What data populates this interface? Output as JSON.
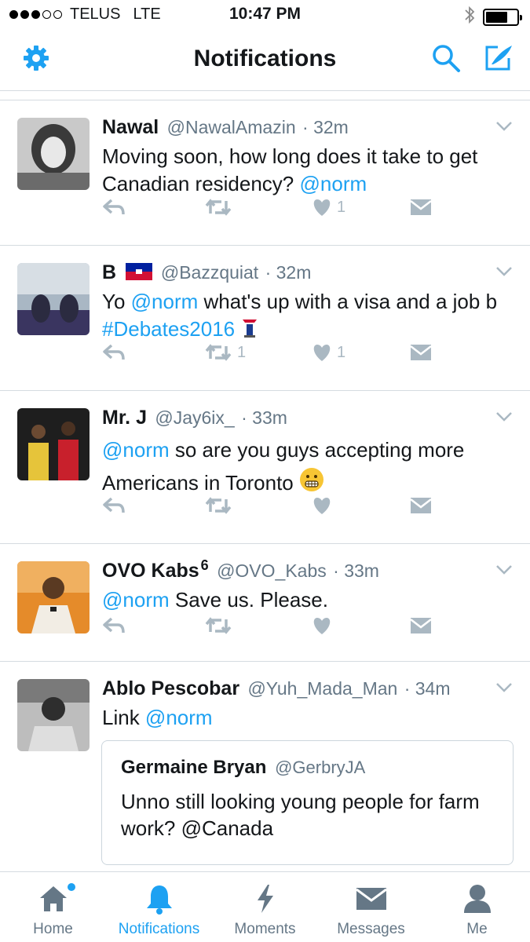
{
  "status_bar": {
    "carrier": "TELUS",
    "network": "LTE",
    "time": "10:47 PM",
    "signal_filled": 3,
    "signal_total": 5,
    "battery_level": 0.7
  },
  "nav": {
    "title": "Notifications",
    "left_icon": "gear-icon",
    "right_icons": [
      "search-icon",
      "compose-icon"
    ],
    "accent": "#1da1f2"
  },
  "tweets": [
    {
      "name": "Nawal",
      "handle": "@NawalAmazin",
      "time": "· 32m",
      "text_pre": "Moving soon, how long does it take to get Canadian residency? ",
      "mention": "@norm",
      "likes": "1",
      "retweets": ""
    },
    {
      "name": "B",
      "flag": "haiti-flag",
      "handle": "@Bazzquiat",
      "time": "· 32m",
      "text_pre": "Yo ",
      "mention": "@norm",
      "text_mid": " what's up with a visa and a job b ",
      "hashtag": "#Debates2016",
      "emoji": "podium-icon",
      "likes": "1",
      "retweets": "1"
    },
    {
      "name": "Mr. J",
      "handle": "@Jay6ix_",
      "time": "· 33m",
      "mention": "@norm",
      "text_post": " so are you guys accepting more Americans in Toronto ",
      "emoji": "grimace-emoji",
      "likes": "",
      "retweets": ""
    },
    {
      "name": "OVO Kabs",
      "name_suffix": "6",
      "handle": "@OVO_Kabs",
      "time": "· 33m",
      "mention": "@norm",
      "text_post": " Save us. Please.",
      "likes": "",
      "retweets": ""
    },
    {
      "name": "Ablo Pescobar",
      "handle": "@Yuh_Mada_Man",
      "time": "· 34m",
      "text_pre": "Link ",
      "mention": "@norm",
      "quote": {
        "name": "Germaine Bryan",
        "handle": "@GerbryJA",
        "text": "Unno still looking young people for farm work? @Canada"
      }
    }
  ],
  "tabs": [
    {
      "label": "Home",
      "icon": "home-icon",
      "active": false,
      "has_dot": true
    },
    {
      "label": "Notifications",
      "icon": "bell-icon",
      "active": true
    },
    {
      "label": "Moments",
      "icon": "lightning-icon",
      "active": false
    },
    {
      "label": "Messages",
      "icon": "envelope-icon",
      "active": false
    },
    {
      "label": "Me",
      "icon": "person-icon",
      "active": false
    }
  ]
}
